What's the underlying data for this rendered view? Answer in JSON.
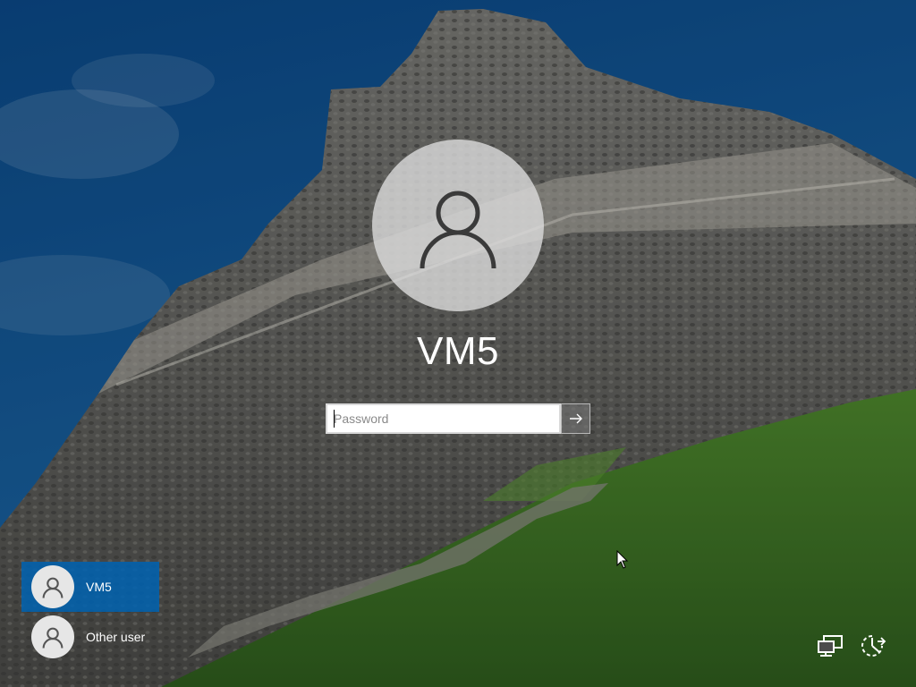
{
  "user": {
    "name": "VM5"
  },
  "password": {
    "placeholder": "Password",
    "value": "",
    "submit_icon": "arrow-right-icon"
  },
  "user_list": [
    {
      "label": "VM5",
      "selected": true,
      "icon": "user-icon"
    },
    {
      "label": "Other user",
      "selected": false,
      "icon": "user-icon"
    }
  ],
  "corner_icons": {
    "network": "network-icon",
    "power": "power-icon"
  },
  "colors": {
    "selected_user": "#0063b1",
    "sky": "#0f4f8f",
    "grass": "#3f7a2a",
    "ruin_stone": "#6f6f6f"
  }
}
